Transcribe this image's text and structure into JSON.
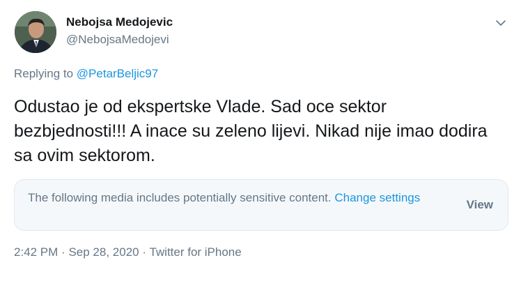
{
  "author": {
    "display_name": "Nebojsa Medojevic",
    "handle": "@NebojsaMedojevi",
    "avatar_icon": "profile-photo"
  },
  "more_icon": "chevron-down-icon",
  "reply": {
    "prefix": "Replying to",
    "mention": "@PetarBeljic97"
  },
  "tweet": {
    "text": "Odustao je od ekspertske Vlade. Sad oce sektor bezbjednosti!!! A inace su zeleno lijevi. Nikad nije imao dodira sa ovim sektorom."
  },
  "media_warning": {
    "message": "The following media includes potentially sensitive content.",
    "change_settings_label": "Change settings",
    "view_label": "View"
  },
  "meta": {
    "time": "2:42 PM",
    "separator": "·",
    "date": "Sep 28, 2020",
    "source": "Twitter for iPhone"
  },
  "colors": {
    "text_primary": "#14171a",
    "text_secondary": "#657786",
    "link": "#1b95e0",
    "media_bg": "#f5f8fa",
    "border": "#e1e8ed"
  }
}
